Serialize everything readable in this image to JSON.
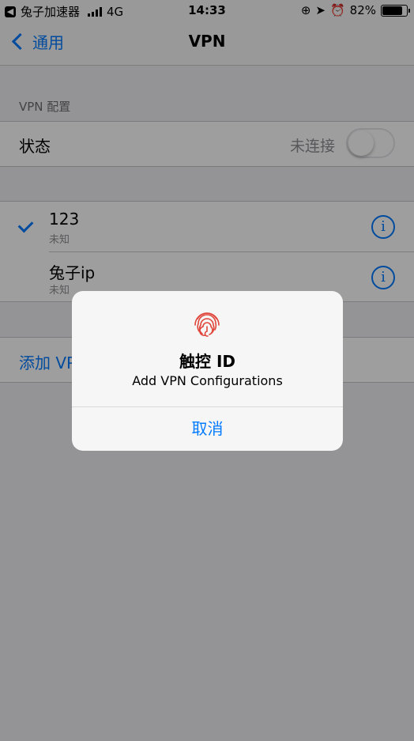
{
  "status_bar": {
    "app_name": "兔子加速器",
    "network": "4G",
    "time": "14:33",
    "battery": "82%",
    "battery_level": 0.82,
    "back_icon": "back-to-app-icon"
  },
  "nav": {
    "back_label": "通用",
    "title": "VPN"
  },
  "section": {
    "header": "VPN 配置"
  },
  "status_row": {
    "label": "状态",
    "value": "未连接",
    "toggle_on": false
  },
  "vpn_items": [
    {
      "name": "123",
      "subtitle": "未知",
      "selected": true
    },
    {
      "name": "兔子ip",
      "subtitle": "未知",
      "selected": false
    }
  ],
  "add_label": "添加 VPN 配置...",
  "alert": {
    "icon": "fingerprint-icon",
    "title": "触控 ID",
    "message": "Add VPN Configurations",
    "cancel_label": "取消"
  },
  "colors": {
    "accent": "#007aff",
    "fingerprint": "#e0463b",
    "background": "#efeff4"
  }
}
